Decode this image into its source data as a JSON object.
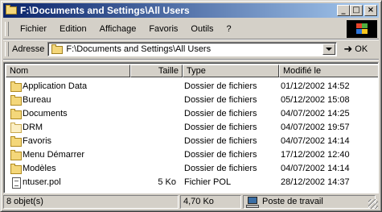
{
  "window": {
    "title": "F:\\Documents and Settings\\All Users",
    "buttons": {
      "minimize": "_",
      "maximize": "□",
      "close": "×"
    }
  },
  "menubar": {
    "items": [
      {
        "label": "Fichier"
      },
      {
        "label": "Edition"
      },
      {
        "label": "Affichage"
      },
      {
        "label": "Favoris"
      },
      {
        "label": "Outils"
      },
      {
        "label": "?"
      }
    ]
  },
  "addressbar": {
    "label": "Adresse",
    "value": "F:\\Documents and Settings\\All Users",
    "go_label": "OK",
    "go_icon": "go-arrow-icon"
  },
  "listview": {
    "columns": [
      {
        "label": "Nom"
      },
      {
        "label": "Taille"
      },
      {
        "label": "Type"
      },
      {
        "label": "Modifié le"
      }
    ],
    "rows": [
      {
        "icon": "folder-icon",
        "name": "Application Data",
        "size": "",
        "type": "Dossier de fichiers",
        "modified": "01/12/2002 14:52"
      },
      {
        "icon": "folder-icon",
        "name": "Bureau",
        "size": "",
        "type": "Dossier de fichiers",
        "modified": "05/12/2002 15:08"
      },
      {
        "icon": "folder-icon",
        "name": "Documents",
        "size": "",
        "type": "Dossier de fichiers",
        "modified": "04/07/2002 14:25"
      },
      {
        "icon": "folder-icon-light",
        "name": "DRM",
        "size": "",
        "type": "Dossier de fichiers",
        "modified": "04/07/2002 19:57"
      },
      {
        "icon": "folder-icon",
        "name": "Favoris",
        "size": "",
        "type": "Dossier de fichiers",
        "modified": "04/07/2002 14:14"
      },
      {
        "icon": "folder-icon",
        "name": "Menu Démarrer",
        "size": "",
        "type": "Dossier de fichiers",
        "modified": "17/12/2002 12:40"
      },
      {
        "icon": "folder-icon",
        "name": "Modèles",
        "size": "",
        "type": "Dossier de fichiers",
        "modified": "04/07/2002 14:14"
      },
      {
        "icon": "file-icon",
        "name": "ntuser.pol",
        "size": "5 Ko",
        "type": "Fichier POL",
        "modified": "28/12/2002 14:37"
      }
    ]
  },
  "statusbar": {
    "count": "8 objet(s)",
    "size": "4,70 Ko",
    "location": "Poste de travail"
  },
  "colors": {
    "title_gradient_start": "#0a246a",
    "title_gradient_end": "#a6caf0",
    "chrome": "#d4d0c8",
    "folder": "#f4d77a"
  }
}
